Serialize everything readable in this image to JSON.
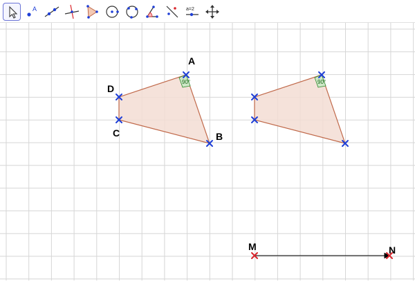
{
  "toolbar": {
    "tools": [
      {
        "name": "move-tool",
        "selected": true
      },
      {
        "name": "point-tool",
        "icon_text": "A"
      },
      {
        "name": "line-tool"
      },
      {
        "name": "perpendicular-line-tool"
      },
      {
        "name": "polygon-tool"
      },
      {
        "name": "circle-tool"
      },
      {
        "name": "circle-through-three-points-tool"
      },
      {
        "name": "angle-tool"
      },
      {
        "name": "reflect-tool"
      },
      {
        "name": "slider-tool",
        "icon_text": "a=2"
      },
      {
        "name": "move-graphics-view-tool"
      }
    ]
  },
  "canvas": {
    "points": {
      "A": "A",
      "B": "B",
      "C": "C",
      "D": "D",
      "M": "M",
      "N": "N"
    },
    "angle_label": "90°",
    "colors": {
      "grid": "#d6d6d6",
      "polygon_fill": "#f3ddd3",
      "polygon_stroke": "#c0694a",
      "point_blue": "#1f3fd6",
      "point_red": "#d9262d",
      "angle_fill": "#cfe8c8",
      "angle_stroke": "#2c8a2c",
      "vector": "#000000"
    }
  }
}
